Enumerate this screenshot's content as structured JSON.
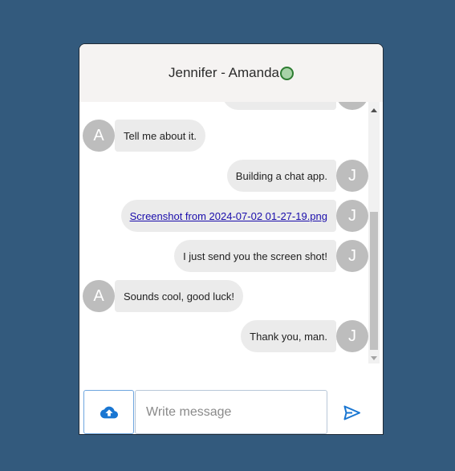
{
  "header": {
    "title": "Jennifer - Amanda",
    "status_color": "#a8d3a8"
  },
  "messages": [
    {
      "side": "right",
      "avatar": "J",
      "text": ""
    },
    {
      "side": "left",
      "avatar": "A",
      "text": "Tell me about it."
    },
    {
      "side": "right",
      "avatar": "J",
      "text": "Building a chat app."
    },
    {
      "side": "right",
      "avatar": "J",
      "text": "Screenshot from 2024-07-02 01-27-19.png",
      "link": true
    },
    {
      "side": "right",
      "avatar": "J",
      "text": "I just send you the screen shot!"
    },
    {
      "side": "left",
      "avatar": "A",
      "text": "Sounds cool, good luck!"
    },
    {
      "side": "right",
      "avatar": "J",
      "text": "Thank you, man."
    }
  ],
  "composer": {
    "placeholder": "Write message",
    "upload_icon": "cloud-upload-icon",
    "send_icon": "send-icon"
  },
  "colors": {
    "background": "#335a7d",
    "accent": "#1976d2",
    "bubble": "#ebebeb",
    "avatar": "#bdbdbd"
  }
}
